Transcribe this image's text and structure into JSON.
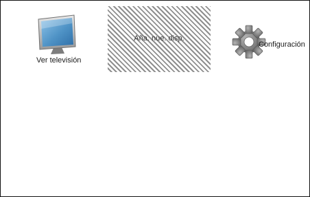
{
  "menu": {
    "items": [
      {
        "id": "watch-tv",
        "label": "Ver televisión",
        "icon": "tv-icon",
        "selected": false
      },
      {
        "id": "add-device",
        "label": "Aña. nue. disp.",
        "icon": "",
        "selected": true
      },
      {
        "id": "settings",
        "label": "Configuración",
        "icon": "gear-icon",
        "selected": false
      }
    ]
  },
  "colors": {
    "background": "#ffffff",
    "border": "#111111",
    "highlight_stripe": "#8e8e8e",
    "tv_screen": "#4f93c6",
    "gear": "#7a7a7a"
  }
}
